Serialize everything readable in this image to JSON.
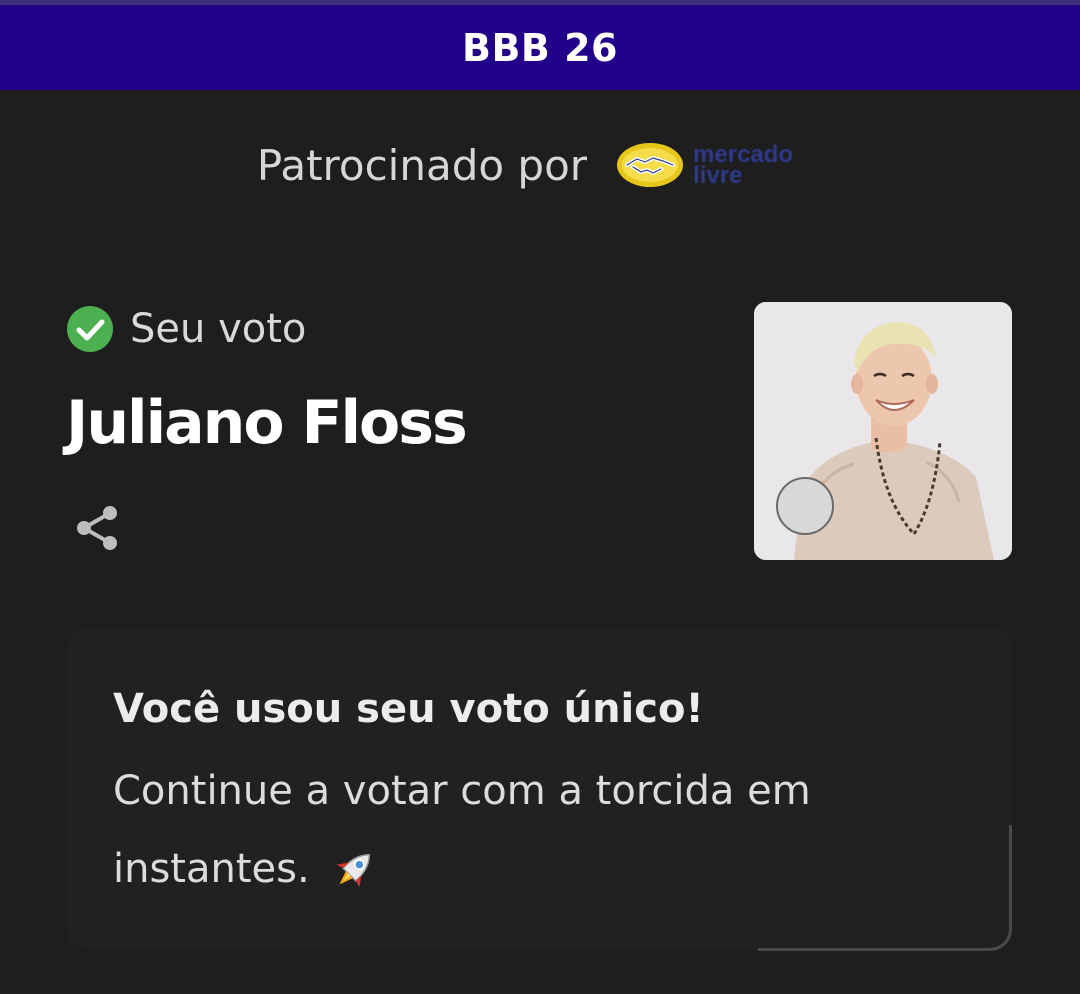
{
  "header": {
    "title": "BBB 26"
  },
  "sponsor": {
    "label": "Patrocinado por",
    "brand_line1": "mercado",
    "brand_line2": "livre",
    "logo_icon": "handshake-icon"
  },
  "vote": {
    "status_label": "Seu voto",
    "status_icon": "check-circle-icon",
    "candidate_name": "Juliano Floss",
    "share_icon": "share-icon",
    "photo": "candidate-photo"
  },
  "message": {
    "title": "Você usou seu voto único!",
    "body_line1": "Continue a votar com a torcida em",
    "body_line2": "instantes.",
    "emoji_icon": "rocket-icon"
  },
  "colors": {
    "header_bg": "#23008a",
    "page_bg": "#1e1e1e",
    "check_green": "#4caf50",
    "card_bg": "#212121"
  }
}
